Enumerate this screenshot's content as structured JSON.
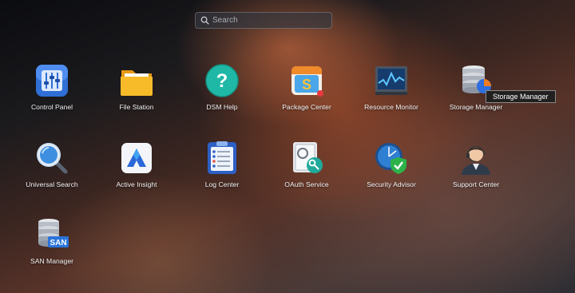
{
  "search": {
    "placeholder": "Search",
    "value": ""
  },
  "tooltip": "Storage Manager",
  "apps": [
    {
      "label": "Control Panel",
      "icon": "control-panel-icon"
    },
    {
      "label": "File Station",
      "icon": "folder-icon"
    },
    {
      "label": "DSM Help",
      "icon": "help-icon"
    },
    {
      "label": "Package Center",
      "icon": "package-center-icon"
    },
    {
      "label": "Resource Monitor",
      "icon": "resource-monitor-icon"
    },
    {
      "label": "Storage Manager",
      "icon": "storage-manager-icon"
    },
    {
      "label": "Universal Search",
      "icon": "magnifier-icon"
    },
    {
      "label": "Active Insight",
      "icon": "active-insight-icon"
    },
    {
      "label": "Log Center",
      "icon": "log-center-icon"
    },
    {
      "label": "OAuth Service",
      "icon": "oauth-key-icon"
    },
    {
      "label": "Security Advisor",
      "icon": "security-shield-icon"
    },
    {
      "label": "Support Center",
      "icon": "support-agent-icon"
    },
    {
      "label": "SAN Manager",
      "icon": "san-manager-icon"
    }
  ]
}
